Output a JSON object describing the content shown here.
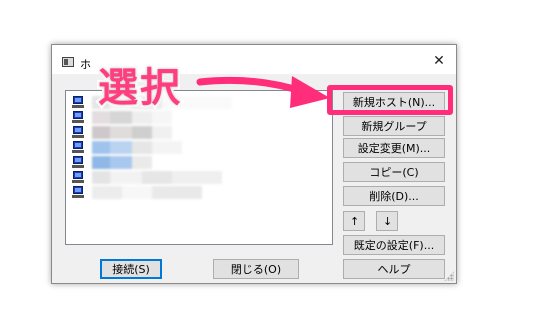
{
  "window": {
    "title": "ホ"
  },
  "annotation": {
    "label": "選択",
    "color": "#ff2d7a"
  },
  "host_list": {
    "rows": 7
  },
  "buttons": {
    "new_host": "新規ホスト(N)...",
    "new_group": "新規グループ(G)...",
    "change_settings": "設定変更(M)...",
    "copy": "コピー(C)",
    "delete": "削除(D)...",
    "move_up": "↑",
    "move_down": "↓",
    "default_settings": "既定の設定(F)...",
    "connect": "接続(S)",
    "close": "閉じる(O)",
    "help": "ヘルプ"
  },
  "icons": {
    "window_icon": "window-icon",
    "close": "close-icon",
    "host": "computer-icon"
  }
}
